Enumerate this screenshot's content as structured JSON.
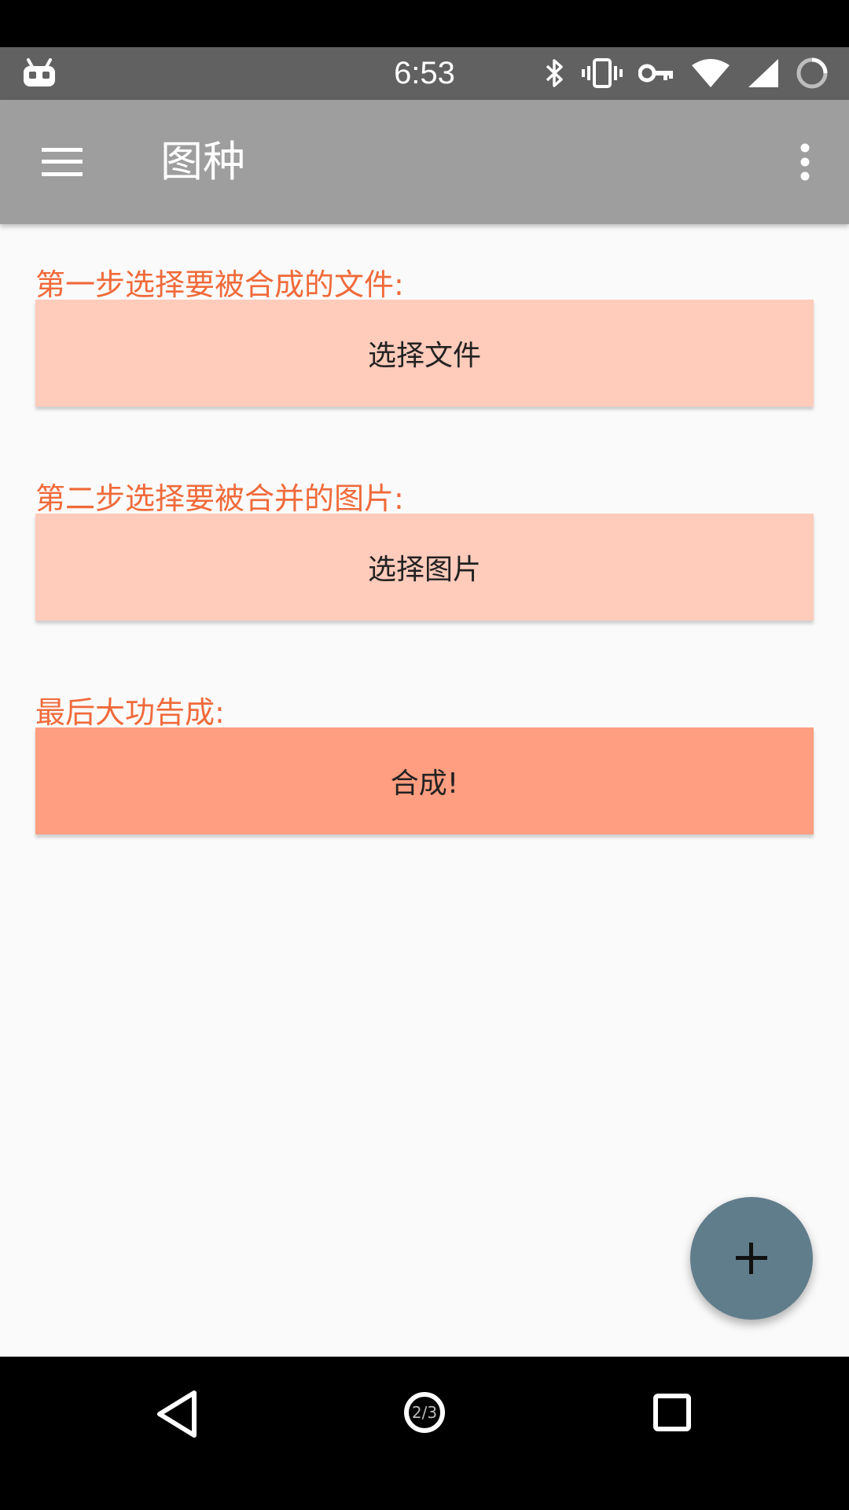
{
  "status_bar": {
    "time": "6:53",
    "left_icon": "android-debug-icon",
    "right_icons": [
      "bluetooth-icon",
      "vibrate-icon",
      "vpn-key-icon",
      "wifi-icon",
      "cell-signal-icon",
      "battery-icon"
    ]
  },
  "app_bar": {
    "title": "图种",
    "menu_icon": "hamburger-menu-icon",
    "overflow_icon": "more-vert-icon"
  },
  "steps": [
    {
      "label": "第一步选择要被合成的文件:",
      "button": "选择文件"
    },
    {
      "label": "第二步选择要被合并的图片:",
      "button": "选择图片"
    },
    {
      "label": "最后大功告成:",
      "button": "合成!"
    }
  ],
  "fab": {
    "icon": "plus-icon"
  },
  "nav_bar": {
    "back_icon": "back-triangle-icon",
    "home_text": "2/3",
    "recent_icon": "recent-apps-square-icon"
  },
  "colors": {
    "label_text": "#f06a3a",
    "button_light": "#ffcbbb",
    "button_strong": "#ff9e80",
    "app_bar": "#9e9e9e",
    "status_bar": "#616161",
    "fab": "#607d8b"
  }
}
